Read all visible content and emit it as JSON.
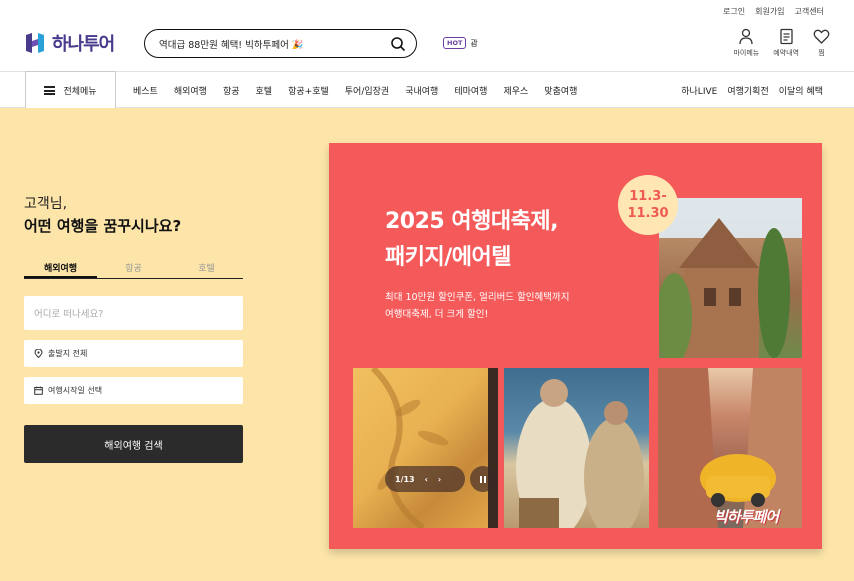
{
  "util_links": [
    "로그인",
    "회원가입",
    "고객센터"
  ],
  "brand": {
    "name": "하나투어",
    "color": "#4a3a8c"
  },
  "search": {
    "value": "역대급 88만원 혜택! 빅하투페어 🎉"
  },
  "hot": {
    "badge": "HOT",
    "text": "괌"
  },
  "user_icons": [
    {
      "label": "마이메뉴",
      "icon": "user-icon"
    },
    {
      "label": "예약내역",
      "icon": "document-icon"
    },
    {
      "label": "찜",
      "icon": "heart-icon"
    }
  ],
  "nav": {
    "all_menu": "전체메뉴",
    "items": [
      "베스트",
      "해외여행",
      "항공",
      "호텔",
      "항공+호텔",
      "투어/입장권",
      "국내여행",
      "테마여행",
      "제우스",
      "맞춤여행"
    ],
    "right": [
      "하나LIVE",
      "여행기획전",
      "이달의 혜택"
    ]
  },
  "hero": {
    "greeting_line1": "고객님,",
    "greeting_line2": "어떤 여행을 꿈꾸시나요?",
    "tabs": [
      "해외여행",
      "항공",
      "호텔"
    ],
    "destination_placeholder": "어디로 떠나세요?",
    "departure": "출발지 전체",
    "date": "여행시작일 선택",
    "search_button": "해외여행 검색",
    "bg_color": "#fde5a9"
  },
  "banner": {
    "title1": "2025 여행대축제,",
    "title2": "패키지/에어텔",
    "sub1": "최대 10만원 할인쿠폰, 얼리버드 할인혜택까지",
    "sub2": "여행대축제, 더 크게 할인!",
    "date_line1": "11.3-",
    "date_line2": "11.30",
    "pager": "1/13",
    "event_logo": "빅하투페어",
    "bg_color": "#f45a5a"
  }
}
